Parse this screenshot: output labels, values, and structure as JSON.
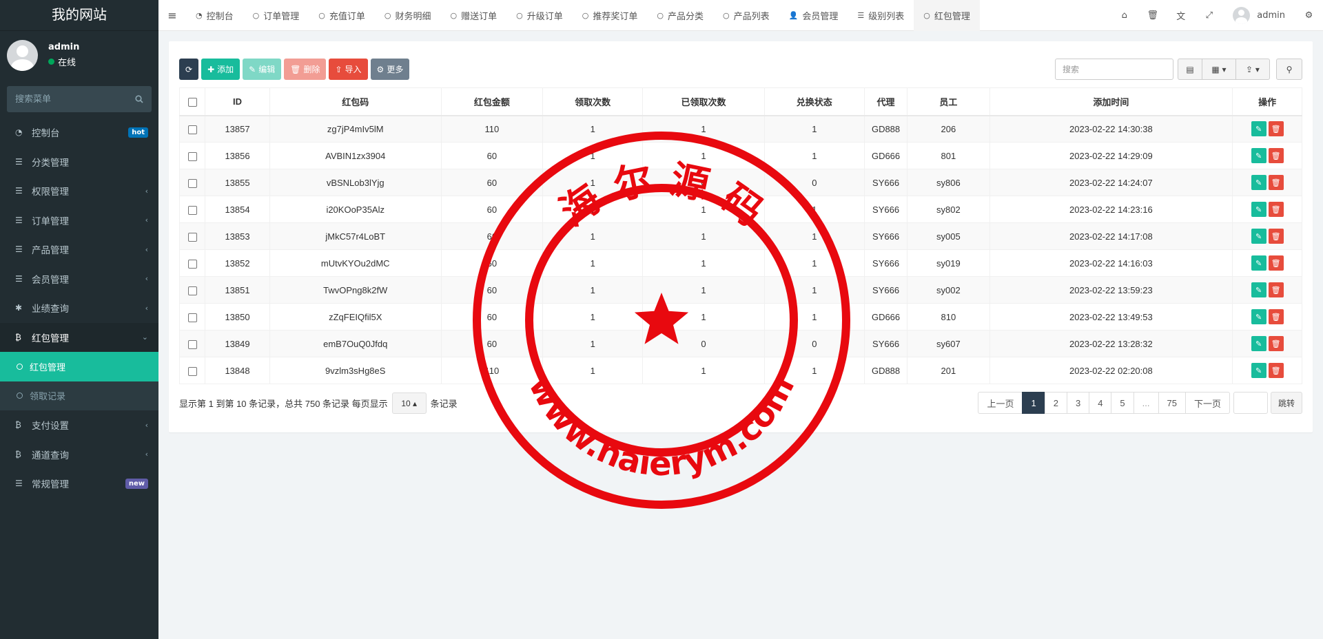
{
  "site_title": "我的网站",
  "user": {
    "name": "admin",
    "status": "在线"
  },
  "sidebar": {
    "search_placeholder": "搜索菜单",
    "items": [
      {
        "label": "控制台",
        "icon": "dashboard-icon",
        "badge": "hot",
        "badge_color": "#0073b7"
      },
      {
        "label": "分类管理",
        "icon": "list-icon"
      },
      {
        "label": "权限管理",
        "icon": "list-icon",
        "chevron": "‹"
      },
      {
        "label": "订单管理",
        "icon": "list-icon",
        "chevron": "‹"
      },
      {
        "label": "产品管理",
        "icon": "list-icon",
        "chevron": "‹"
      },
      {
        "label": "会员管理",
        "icon": "list-icon",
        "chevron": "‹"
      },
      {
        "label": "业绩查询",
        "icon": "asterisk-icon",
        "chevron": "‹"
      },
      {
        "label": "红包管理",
        "icon": "bitcoin-icon",
        "chevron": "⌄",
        "open": true
      },
      {
        "label": "支付设置",
        "icon": "bitcoin-icon",
        "chevron": "‹"
      },
      {
        "label": "通道查询",
        "icon": "bitcoin-icon",
        "chevron": "‹"
      },
      {
        "label": "常规管理",
        "icon": "list-icon",
        "badge": "new",
        "badge_color": "#605ca8"
      }
    ],
    "submenu": [
      {
        "label": "红包管理",
        "active": true
      },
      {
        "label": "领取记录"
      }
    ]
  },
  "topbar": {
    "tabs": [
      {
        "label": "控制台",
        "icon": "dashboard-icon"
      },
      {
        "label": "订单管理",
        "icon": "circle-icon"
      },
      {
        "label": "充值订单",
        "icon": "circle-icon"
      },
      {
        "label": "财务明细",
        "icon": "circle-icon"
      },
      {
        "label": "赠送订单",
        "icon": "circle-icon"
      },
      {
        "label": "升级订单",
        "icon": "circle-icon"
      },
      {
        "label": "推荐奖订单",
        "icon": "circle-icon"
      },
      {
        "label": "产品分类",
        "icon": "circle-icon"
      },
      {
        "label": "产品列表",
        "icon": "circle-icon"
      },
      {
        "label": "会员管理",
        "icon": "user-icon"
      },
      {
        "label": "级别列表",
        "icon": "list-icon"
      },
      {
        "label": "红包管理",
        "icon": "circle-icon",
        "active": true
      }
    ],
    "username": "admin"
  },
  "toolbar": {
    "refresh": "",
    "add": "添加",
    "edit": "编辑",
    "delete": "删除",
    "import": "导入",
    "more": "更多",
    "search_placeholder": "搜索"
  },
  "table": {
    "columns": [
      "ID",
      "红包码",
      "红包金额",
      "领取次数",
      "已领取次数",
      "兑换状态",
      "代理",
      "员工",
      "添加时间",
      "操作"
    ],
    "rows": [
      [
        "13857",
        "zg7jP4mIv5lM",
        "110",
        "1",
        "1",
        "1",
        "GD888",
        "206",
        "2023-02-22 14:30:38"
      ],
      [
        "13856",
        "AVBIN1zx3904",
        "60",
        "1",
        "1",
        "1",
        "GD666",
        "801",
        "2023-02-22 14:29:09"
      ],
      [
        "13855",
        "vBSNLob3lYjg",
        "60",
        "1",
        "0",
        "0",
        "SY666",
        "sy806",
        "2023-02-22 14:24:07"
      ],
      [
        "13854",
        "i20KOoP35Alz",
        "60",
        "1",
        "1",
        "1",
        "SY666",
        "sy802",
        "2023-02-22 14:23:16"
      ],
      [
        "13853",
        "jMkC57r4LoBT",
        "60",
        "1",
        "1",
        "1",
        "SY666",
        "sy005",
        "2023-02-22 14:17:08"
      ],
      [
        "13852",
        "mUtvKYOu2dMC",
        "60",
        "1",
        "1",
        "1",
        "SY666",
        "sy019",
        "2023-02-22 14:16:03"
      ],
      [
        "13851",
        "TwvOPng8k2fW",
        "60",
        "1",
        "1",
        "1",
        "SY666",
        "sy002",
        "2023-02-22 13:59:23"
      ],
      [
        "13850",
        "zZqFEIQfil5X",
        "60",
        "1",
        "1",
        "1",
        "GD666",
        "810",
        "2023-02-22 13:49:53"
      ],
      [
        "13849",
        "emB7OuQ0Jfdq",
        "60",
        "1",
        "0",
        "0",
        "SY666",
        "sy607",
        "2023-02-22 13:28:32"
      ],
      [
        "13848",
        "9vzlm3sHg8eS",
        "110",
        "1",
        "1",
        "1",
        "GD888",
        "201",
        "2023-02-22 02:20:08"
      ]
    ]
  },
  "footer": {
    "info_prefix": "显示第 1 到第 10 条记录，总共 750 条记录 每页显示",
    "page_size": "10",
    "info_suffix": "条记录"
  },
  "pagination": {
    "prev": "上一页",
    "pages": [
      "1",
      "2",
      "3",
      "4",
      "5",
      "...",
      "75"
    ],
    "next": "下一页",
    "jump": "跳转"
  },
  "stamp": {
    "top_text": "海 尔 源 码",
    "bottom_text": "www.haierym.com",
    "color": "#e8090f"
  }
}
